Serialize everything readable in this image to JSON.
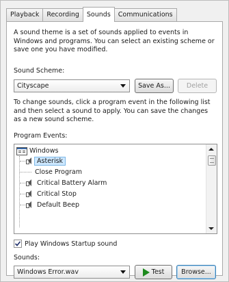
{
  "tabs": [
    {
      "label": "Playback"
    },
    {
      "label": "Recording"
    },
    {
      "label": "Sounds"
    },
    {
      "label": "Communications"
    }
  ],
  "active_tab_index": 2,
  "intro_text": "A sound theme is a set of sounds applied to events in Windows and programs.  You can select an existing scheme or save one you have modified.",
  "scheme": {
    "label": "Sound Scheme:",
    "value": "Cityscape",
    "save_as_label": "Save As...",
    "delete_label": "Delete"
  },
  "change_text": "To change sounds, click a program event in the following list and then select a sound to apply.  You can save the changes as a new sound scheme.",
  "program_events": {
    "label": "Program Events:",
    "root": "Windows",
    "items": [
      {
        "label": "Asterisk",
        "has_sound": true,
        "selected": true
      },
      {
        "label": "Close Program",
        "has_sound": false,
        "selected": false
      },
      {
        "label": "Critical Battery Alarm",
        "has_sound": true,
        "selected": false
      },
      {
        "label": "Critical Stop",
        "has_sound": true,
        "selected": false
      },
      {
        "label": "Default Beep",
        "has_sound": true,
        "selected": false
      }
    ]
  },
  "startup": {
    "label": "Play Windows Startup sound",
    "checked": true
  },
  "sounds": {
    "label": "Sounds:",
    "value": "Windows Error.wav",
    "test_label": "Test",
    "browse_label": "Browse..."
  },
  "icons": {
    "tree_root": "window-icon",
    "event": "speaker-icon",
    "test": "play-icon",
    "dropdown": "chevron-down-icon"
  }
}
